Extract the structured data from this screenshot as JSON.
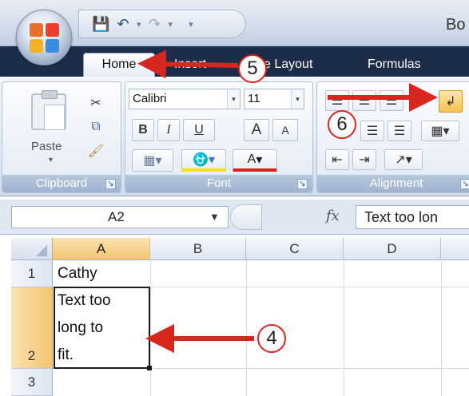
{
  "title_bar": {
    "text": "Bo"
  },
  "quick_access": {
    "save_icon": "save-icon",
    "undo_icon": "undo-icon",
    "redo_icon": "redo-icon"
  },
  "tabs": [
    {
      "label": "Home",
      "active": true
    },
    {
      "label": "Insert"
    },
    {
      "label": "e Layout"
    },
    {
      "label": "Formulas"
    }
  ],
  "ribbon": {
    "clipboard": {
      "paste_label": "Paste",
      "group_label": "Clipboard"
    },
    "font": {
      "font_name": "Calibri",
      "font_size": "11",
      "bold": "B",
      "italic": "I",
      "underline": "U",
      "grow": "A",
      "shrink": "A",
      "font_color": "A",
      "group_label": "Font"
    },
    "alignment": {
      "group_label": "Alignment"
    }
  },
  "formula_bar": {
    "name_box": "A2",
    "fx": "fx",
    "content": "Text too lon"
  },
  "grid": {
    "columns": [
      "A",
      "B",
      "C",
      "D"
    ],
    "rows": [
      "1",
      "2",
      "3"
    ],
    "cells": {
      "A1": "Cathy",
      "A2_line1": "Text too",
      "A2_line2": "long to",
      "A2_line3": "fit."
    }
  },
  "annotations": {
    "step_4": "4",
    "step_5": "5",
    "step_6": "6"
  },
  "colors": {
    "arrow_red": "#d7261e",
    "selection_orange": "#f5c46f",
    "ribbon_blue": "#1d2c48"
  }
}
